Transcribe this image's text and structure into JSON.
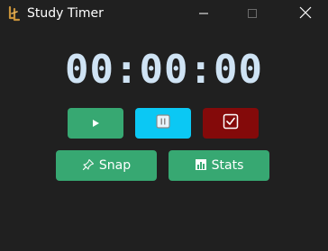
{
  "window": {
    "title": "Study Timer",
    "app_icon": "study-timer-logo-icon",
    "controls": [
      "minimize-icon",
      "maximize-icon",
      "close-icon"
    ]
  },
  "timer": {
    "display": "00:00:00"
  },
  "controls": {
    "start_icon": "play-icon",
    "pause_icon": "pause-icon",
    "stop_icon": "checkbox-icon"
  },
  "actions": {
    "snap_label": "Snap",
    "snap_icon": "pin-icon",
    "stats_label": "Stats",
    "stats_icon": "bar-chart-icon"
  },
  "colors": {
    "background": "#202020",
    "timer_text": "#cfe3f4",
    "green_button": "#37a872",
    "cyan_button": "#0bc8f4",
    "red_button": "#840a0a"
  }
}
